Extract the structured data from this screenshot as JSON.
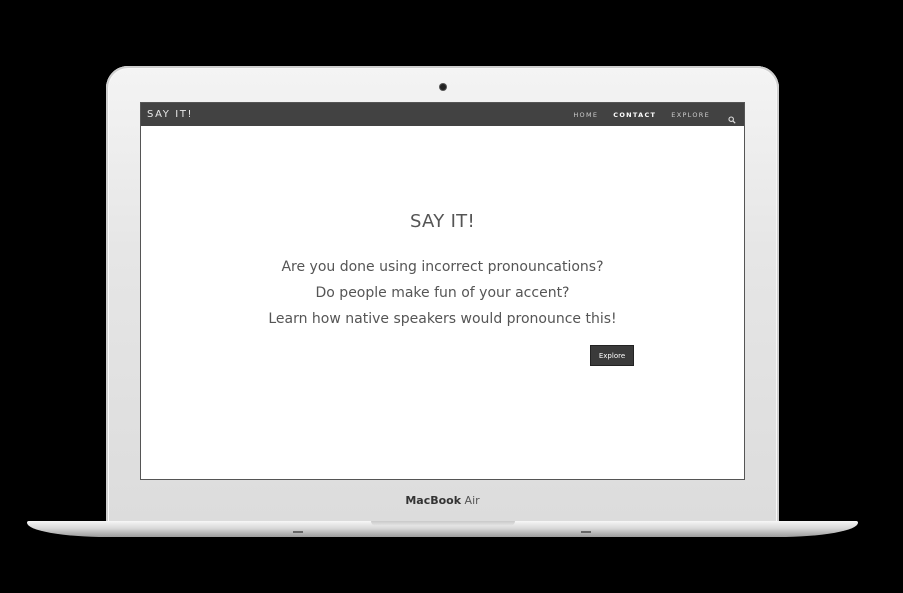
{
  "device": {
    "model_bold": "MacBook",
    "model_light": "Air"
  },
  "navbar": {
    "brand": "SAY IT!",
    "links": [
      {
        "label": "HOME"
      },
      {
        "label": "CONTACT"
      },
      {
        "label": "EXPLORE"
      }
    ],
    "active_link": "CONTACT",
    "search_icon": "search-icon",
    "background_color": "#424242"
  },
  "hero": {
    "title": "SAY IT!",
    "lines": [
      "Are you done using incorrect pronouncations?",
      "Do people make fun of your accent?",
      "Learn how native speakers would pronounce this!"
    ],
    "button_label": "Explore"
  }
}
